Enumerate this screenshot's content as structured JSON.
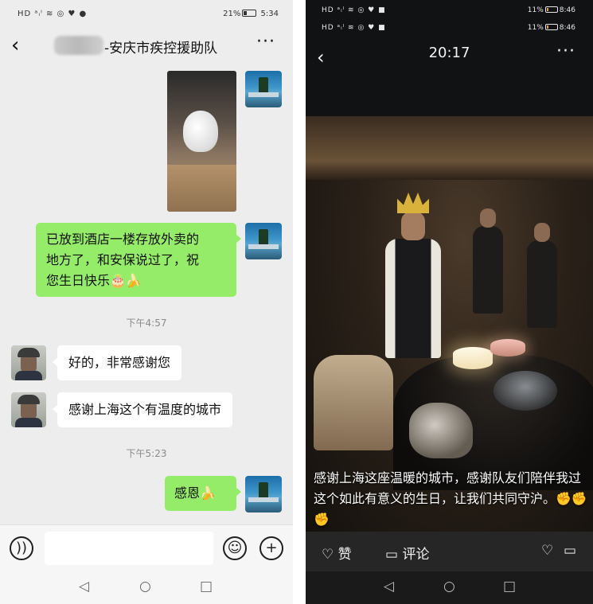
{
  "left": {
    "status": {
      "signal": "HD ᵃᵢˡ ≋ ◎ ♥ ●",
      "battery": "21%",
      "time": "5:34"
    },
    "nav": {
      "back": "‹",
      "title": "-安庆市疾控援助队",
      "more": "···"
    },
    "messages": [
      {
        "type": "image",
        "from": "me"
      },
      {
        "type": "text",
        "from": "me",
        "lines": [
          "已放到酒店一楼存放外卖的",
          "地方了，和安保说过了，祝",
          "您生日快乐🎂🍌"
        ]
      },
      {
        "type": "timestamp",
        "text": "下午4:57"
      },
      {
        "type": "text",
        "from": "him",
        "text": "好的，非常感谢您"
      },
      {
        "type": "text",
        "from": "him",
        "text": "感谢上海这个有温度的城市"
      },
      {
        "type": "timestamp",
        "text": "下午5:23"
      },
      {
        "type": "text",
        "from": "me",
        "text": "感恩🍌"
      }
    ],
    "input": {
      "voice_icon": "voice-icon",
      "emoji_icon": "emoji-icon",
      "plus_icon": "plus-icon"
    },
    "softnav": {
      "back": "◁",
      "home": "○",
      "recent": "□"
    }
  },
  "right": {
    "status1": {
      "signal": "HD ᵃᵢˡ ≋ ◎ ♥ ■",
      "battery": "11%",
      "time": "8:46"
    },
    "status2": {
      "signal": "HD ᵃᵢˡ ≋ ◎ ♥ ■",
      "battery": "11%",
      "time": "8:46"
    },
    "nav": {
      "back": "‹",
      "time": "20:17",
      "more": "···"
    },
    "caption": "感谢上海这座温暖的城市，感谢队友们陪伴我过这个如此有意义的生日，让我们共同守沪。✊✊✊",
    "actions": {
      "like": "赞",
      "comment": "评论"
    },
    "softnav": {
      "back": "◁",
      "home": "○",
      "recent": "□"
    }
  }
}
